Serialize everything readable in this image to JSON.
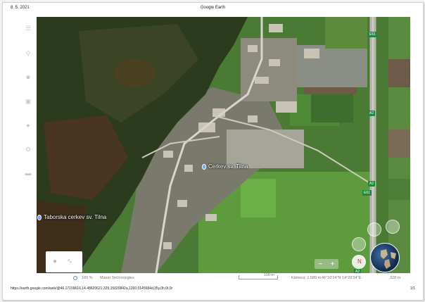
{
  "header": {
    "date": "8. 5. 2021",
    "title": "Google Earth"
  },
  "footer": {
    "url": "https://earth.google.com/web/@46.17109616,14.48620621,329.15020842a,1260.0145684d,35y,0h,0t,0r",
    "page": "1/1"
  },
  "left_rail": {
    "icons": [
      "menu-icon",
      "search-icon",
      "voyager-icon",
      "feeling-lucky-icon",
      "projects-icon",
      "measure-icon",
      "settings-icon"
    ]
  },
  "map": {
    "labels": {
      "church_main": "Cerkev sv. Tilna",
      "church_left": "Taborska cerkev sv. Tilna"
    },
    "road_shields": {
      "e61_top": "E61",
      "a2_mid": "A2",
      "a2_lower": "A2",
      "e61_lower": "E61",
      "a2_bottom": "A2"
    },
    "zoom": {
      "minus": "−",
      "plus": "+"
    },
    "compass_label": "N"
  },
  "status_bar": {
    "zoom_percent": "100 %",
    "attribution": "Maxar Technologies",
    "scale": "100 m",
    "camera": "Kamera: 1.589 m",
    "coordinates": "46°10'24\"N 14°29'34\"E",
    "altitude": "328 m"
  },
  "colors": {
    "road_shield": "#1e8a3c",
    "pin": "#6fa5ff"
  }
}
